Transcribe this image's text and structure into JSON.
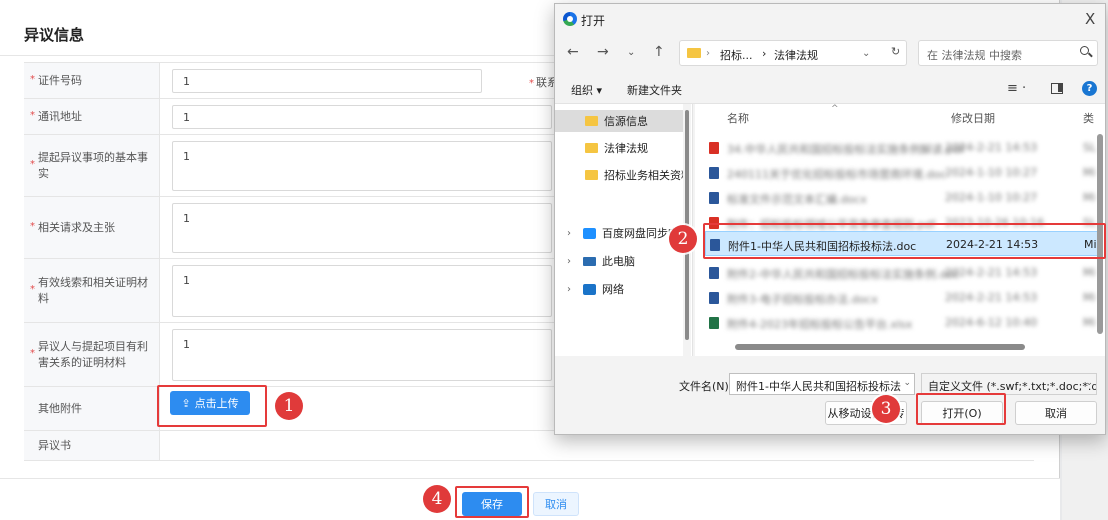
{
  "form": {
    "title": "异议信息",
    "rows": [
      {
        "label": "证件号码",
        "value": "1",
        "extra": "联系"
      },
      {
        "label": "通讯地址",
        "value": "1"
      },
      {
        "label": "提起异议事项的基本事实",
        "value": "1"
      },
      {
        "label": "相关请求及主张",
        "value": "1"
      },
      {
        "label": "有效线索和相关证明材料",
        "value": "1"
      },
      {
        "label": "异议人与提起项目有利害关系的证明材料",
        "value": "1"
      },
      {
        "label": "其他附件"
      },
      {
        "label": "异议书"
      }
    ],
    "required_mark": "*",
    "upload_button": "点击上传",
    "upload_icon": "upload-icon",
    "save_button": "保存",
    "cancel_button": "取消"
  },
  "steps": [
    "1",
    "2",
    "3",
    "4"
  ],
  "dialog": {
    "title": "打开",
    "close_glyph": "X",
    "address": {
      "crumbs": [
        "招标...",
        "法律法规"
      ],
      "separator": "›"
    },
    "search_placeholder": "在 法律法规 中搜索",
    "toolbar": {
      "organize": "组织",
      "new_folder": "新建文件夹"
    },
    "help_glyph": "?",
    "nav_items": [
      {
        "label": "信源信息",
        "icon": "folder-icon",
        "selected": true
      },
      {
        "label": "法律法规",
        "icon": "folder-icon"
      },
      {
        "label": "招标业务相关资料",
        "icon": "folder-icon"
      },
      {
        "label": "百度网盘同步空间",
        "icon": "cloud-icon",
        "expandable": true
      },
      {
        "label": "此电脑",
        "icon": "computer-icon",
        "expandable": true
      },
      {
        "label": "网络",
        "icon": "network-icon",
        "expandable": true
      }
    ],
    "columns": {
      "name": "名称",
      "date": "修改日期",
      "type": "类"
    },
    "files": [
      {
        "name": "34.中华人民共和国招标投标法实施条例解读.pdf",
        "date": "2024-2-21 14:53",
        "type": "SL",
        "blurred": true,
        "color": "#d93025"
      },
      {
        "name": "240111关于优化招标投标市场营商环境.doc",
        "date": "2024-1-10 10:27",
        "type": "Mi",
        "blurred": true,
        "color": "#2b579a"
      },
      {
        "name": "标准文件示范文本汇编.docx",
        "date": "2024-1-10 10:27",
        "type": "Mi",
        "blurred": true,
        "color": "#2b579a"
      },
      {
        "name": "附件：招标投标领域公平竞争审查规则.pdf",
        "date": "2023-10-26 10:16",
        "type": "SL",
        "blurred": true,
        "color": "#d93025"
      },
      {
        "name": "附件1-中华人民共和国招标投标法.doc",
        "date": "2024-2-21 14:53",
        "type": "Mi",
        "blurred": false,
        "color": "#2b579a",
        "selected": true
      },
      {
        "name": "附件2-中华人民共和国招标投标法实施条例.doc",
        "date": "2024-2-21 14:53",
        "type": "Mi",
        "blurred": true,
        "color": "#2b579a"
      },
      {
        "name": "附件3-电子招标投标办法.docx",
        "date": "2024-2-21 14:53",
        "type": "Mi",
        "blurred": true,
        "color": "#2b579a"
      },
      {
        "name": "附件4-2023年招标投标公告平台.xlsx",
        "date": "2024-6-12 10:40",
        "type": "Mi",
        "blurred": true,
        "color": "#217346"
      }
    ],
    "filename_label": "文件名(N):",
    "filename_value": "附件1-中华人民共和国招标投标法",
    "filter_value": "自定义文件 (*.swf;*.txt;*.doc;*.docx",
    "btn_mobile": "从移动设备上传",
    "btn_open": "打开(O)",
    "btn_cancel": "取消"
  },
  "colors": {
    "primary": "#2d8cf0",
    "highlight": "#e53a3a",
    "selection": "#cce8ff"
  }
}
